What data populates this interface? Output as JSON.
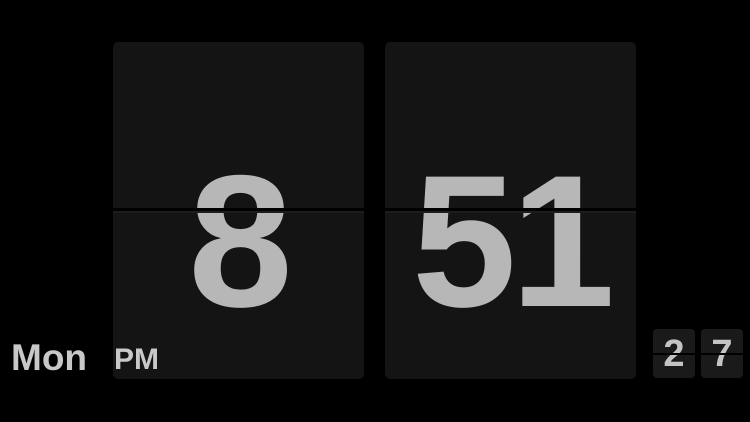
{
  "clock": {
    "hour": "8",
    "minutes": "51",
    "seconds_tens": "2",
    "seconds_ones": "7",
    "day": "Mon",
    "meridiem": "PM"
  },
  "colors": {
    "background": "#000000",
    "card": "#141414",
    "digit": "#b7b7b7",
    "label": "#c8c8c8"
  }
}
